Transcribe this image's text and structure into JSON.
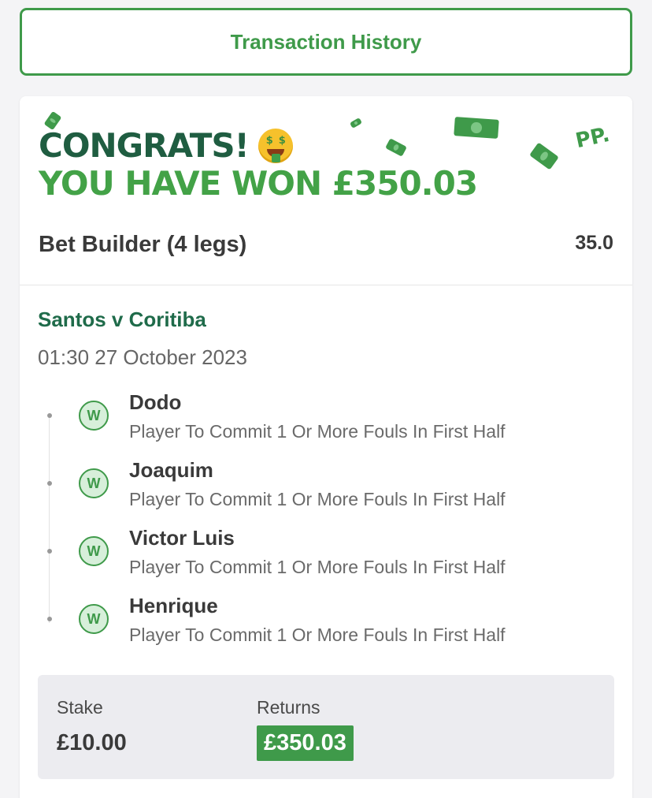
{
  "header": {
    "transaction_history_label": "Transaction History"
  },
  "banner": {
    "congrats": "CONGRATS!",
    "emoji": "money-mouth-face-icon",
    "emoji_eye": "$",
    "won_text": "YOU HAVE WON £350.03",
    "logo": "PP."
  },
  "bet": {
    "title": "Bet Builder (4 legs)",
    "odds": "35.0"
  },
  "event": {
    "name": "Santos v Coritiba",
    "datetime": "01:30 27 October 2023"
  },
  "legs": [
    {
      "result": "W",
      "player": "Dodo",
      "market": "Player To Commit 1 Or More Fouls In First Half"
    },
    {
      "result": "W",
      "player": "Joaquim",
      "market": "Player To Commit 1 Or More Fouls In First Half"
    },
    {
      "result": "W",
      "player": "Victor Luis",
      "market": "Player To Commit 1 Or More Fouls In First Half"
    },
    {
      "result": "W",
      "player": "Henrique",
      "market": "Player To Commit 1 Or More Fouls In First Half"
    }
  ],
  "summary": {
    "stake_label": "Stake",
    "stake_value": "£10.00",
    "returns_label": "Returns",
    "returns_value": "£350.03"
  },
  "colors": {
    "brand_green": "#3f9a4a",
    "dark_green": "#1f5d41",
    "light_green": "#43a247"
  }
}
